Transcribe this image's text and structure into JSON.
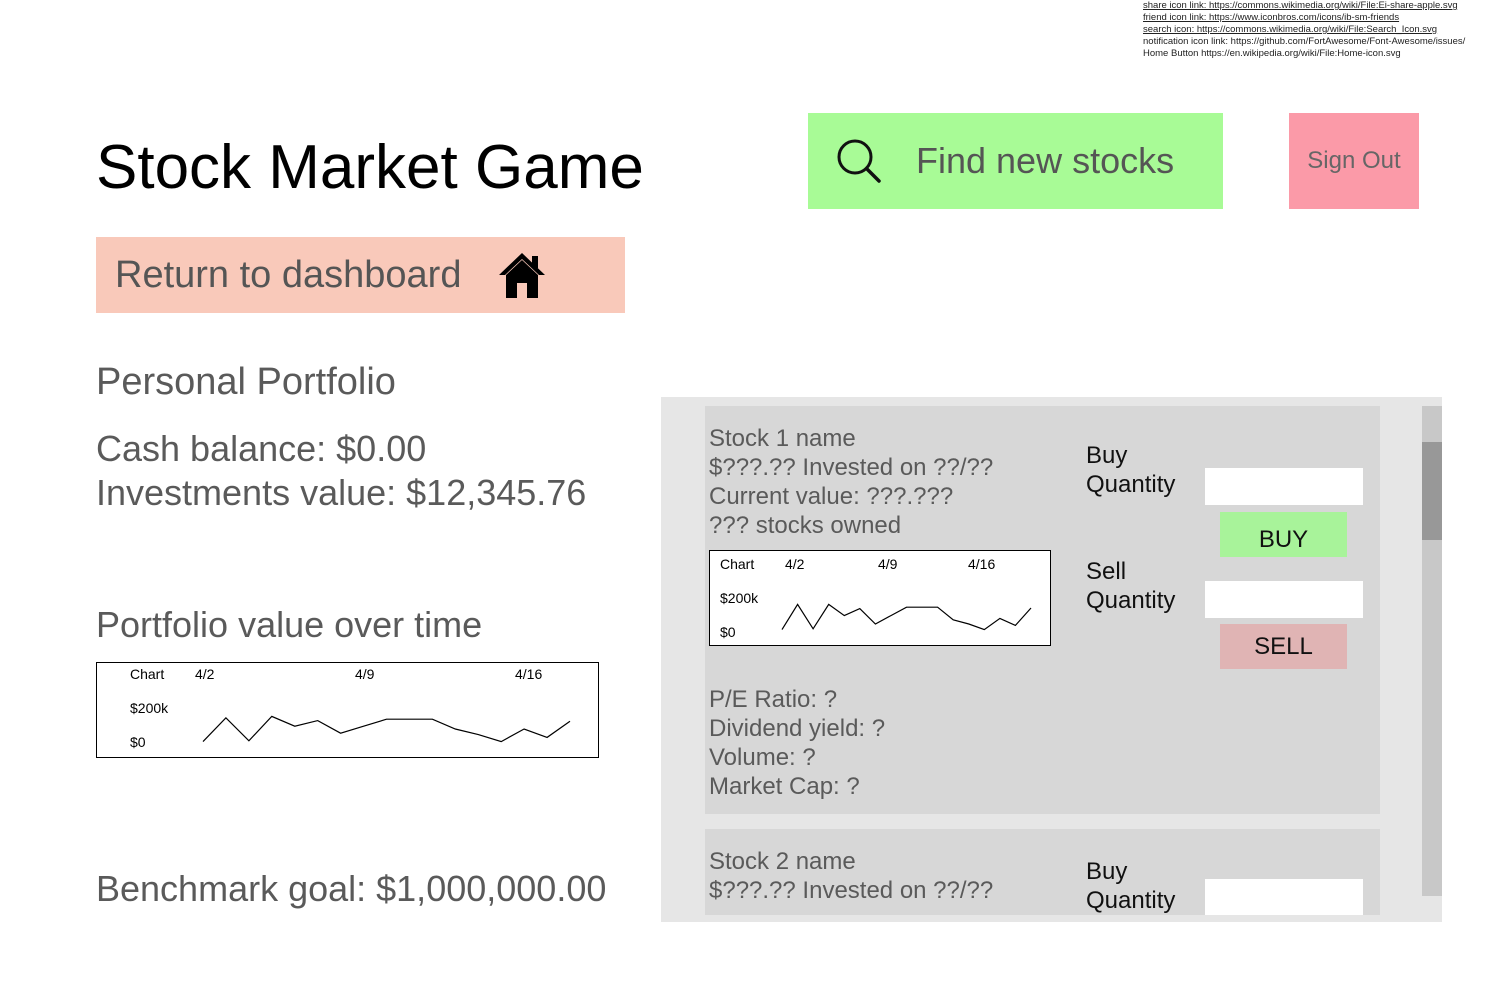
{
  "credits": [
    "share icon link: https://commons.wikimedia.org/wiki/File:Ei-share-apple.svg",
    "friend icon link: https://www.iconbros.com/icons/ib-sm-friends",
    "search icon: https://commons.wikimedia.org/wiki/File:Search_Icon.svg",
    "notification icon link: https://github.com/FortAwesome/Font-Awesome/issues/",
    "Home Button https://en.wikipedia.org/wiki/File:Home-icon.svg"
  ],
  "header": {
    "title": "Stock Market Game",
    "find_label": "Find new stocks",
    "find_icon": "search-icon",
    "signout_label": "Sign Out",
    "dashboard_label": "Return to dashboard",
    "dashboard_icon": "home-icon"
  },
  "colors": {
    "find": "#a8fb96",
    "signout": "#fb9aa8",
    "dashboard": "#f9c9ba",
    "buy": "#a8f39a",
    "sell": "#e0b4b4",
    "panel": "#e6e6e6",
    "card": "#d7d7d7"
  },
  "portfolio": {
    "heading": "Personal Portfolio",
    "cash": "Cash balance: $0.00",
    "investments": "Investments value: $12,345.76",
    "chart_heading": "Portfolio value over time",
    "benchmark": "Benchmark goal: $1,000,000.00"
  },
  "stocks": [
    {
      "name": "Stock 1 name",
      "invested": "$???.?? Invested on ??/??",
      "current": "Current value: ???.???",
      "owned": "??? stocks owned",
      "pe": "P/E Ratio: ?",
      "dividend": "Dividend yield: ?",
      "volume": "Volume: ?",
      "market_cap": "Market Cap: ?",
      "buy_label_1": "Buy",
      "buy_label_2": "Quantity",
      "sell_label_1": "Sell",
      "sell_label_2": "Quantity",
      "buy_button": "BUY",
      "sell_button": "SELL"
    },
    {
      "name": "Stock 2 name",
      "invested": "$???.?? Invested on ??/??",
      "buy_label_1": "Buy",
      "buy_label_2": "Quantity"
    }
  ],
  "chart_data": [
    {
      "type": "line",
      "title": "Chart",
      "x_ticks": [
        "4/2",
        "4/9",
        "4/16"
      ],
      "y_ticks": [
        "$200k",
        "$0"
      ],
      "values": [
        0.05,
        0.9,
        0.08,
        0.95,
        0.6,
        0.8,
        0.35,
        0.6,
        0.85,
        0.85,
        0.85,
        0.5,
        0.3,
        0.05,
        0.5,
        0.2,
        0.78
      ]
    },
    {
      "type": "line",
      "title": "Chart",
      "x_ticks": [
        "4/2",
        "4/9",
        "4/16"
      ],
      "y_ticks": [
        "$200k",
        "$0"
      ],
      "values": [
        0.05,
        0.95,
        0.08,
        0.95,
        0.55,
        0.8,
        0.25,
        0.55,
        0.85,
        0.85,
        0.85,
        0.4,
        0.25,
        0.05,
        0.45,
        0.2,
        0.82
      ]
    }
  ]
}
